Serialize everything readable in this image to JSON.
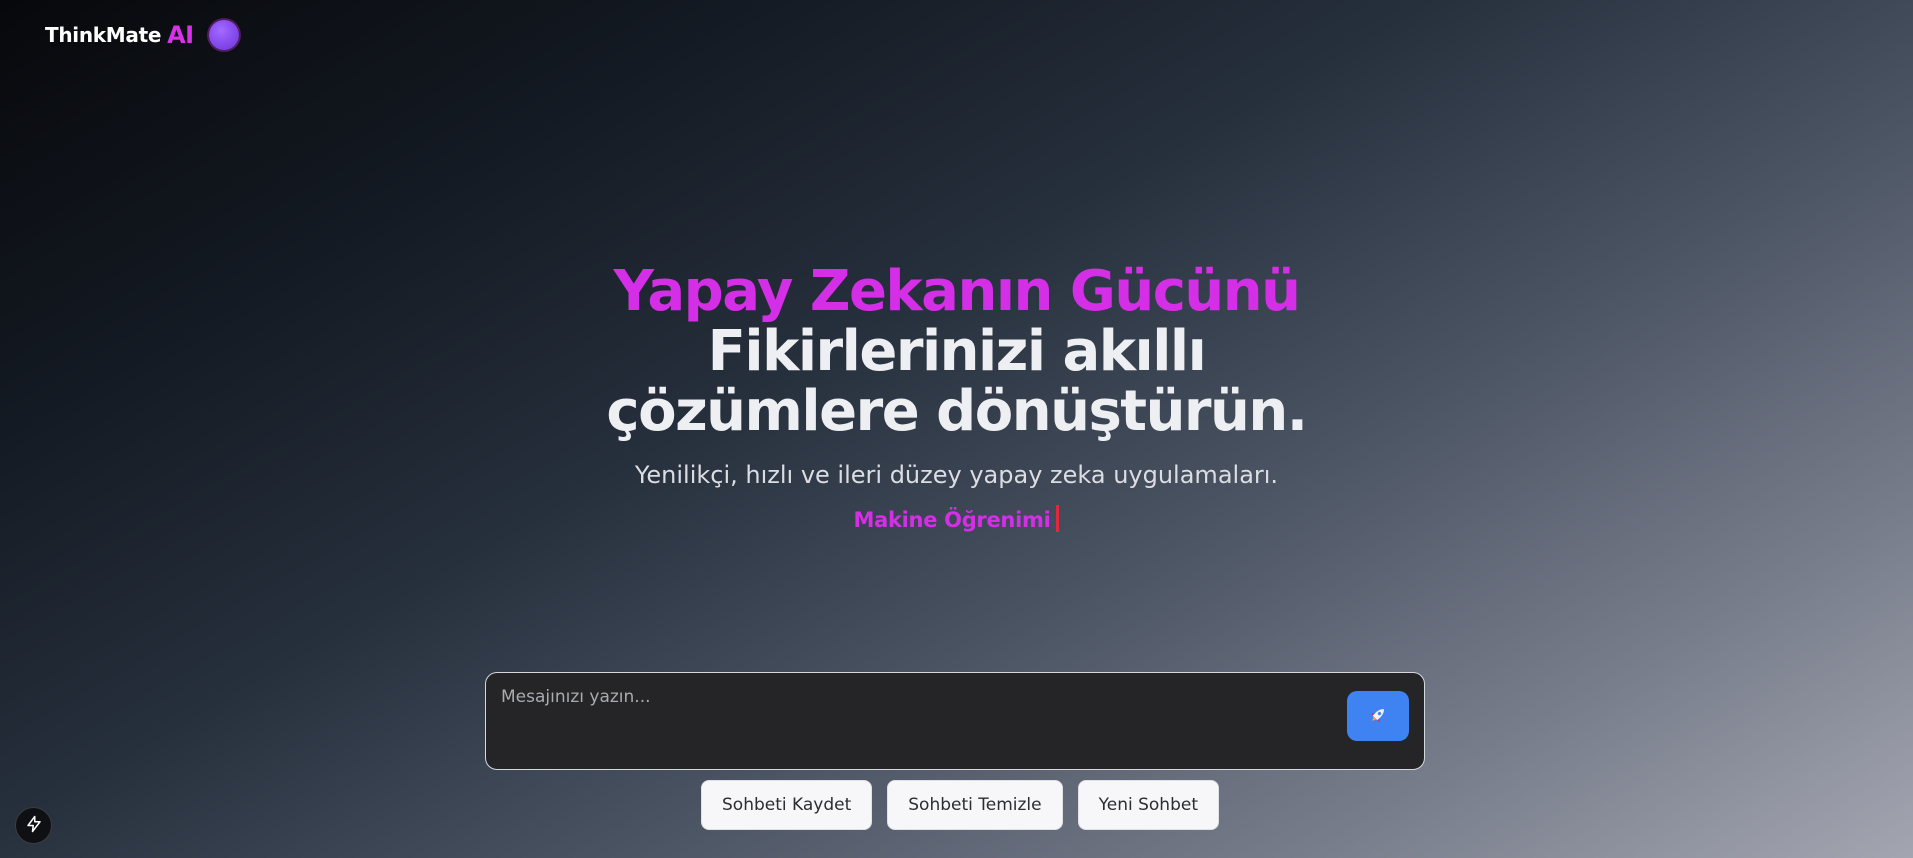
{
  "header": {
    "brand_name": "ThinkMate",
    "brand_suffix": "AI",
    "brand_icon": "gradient-orb-icon"
  },
  "hero": {
    "line1": "Yapay Zekanın Gücünü",
    "line2": "Fikirlerinizi akıllı",
    "line3": "çözümlere dönüştürün.",
    "subtitle": "Yenilikçi, hızlı ve ileri düzey yapay zeka uygulamaları.",
    "typing_text": "Makine Öğrenimi"
  },
  "composer": {
    "placeholder": "Mesajınızı yazın...",
    "value": "",
    "send_icon": "rocket-icon"
  },
  "actions": {
    "save_label": "Sohbeti Kaydet",
    "clear_label": "Sohbeti Temizle",
    "new_label": "Yeni Sohbet"
  },
  "floating": {
    "icon": "bolt-icon"
  },
  "colors": {
    "accent_magenta": "#d42fe6",
    "send_button": "#3f82f2",
    "cursor": "#e0283e",
    "composer_bg": "#252527"
  }
}
